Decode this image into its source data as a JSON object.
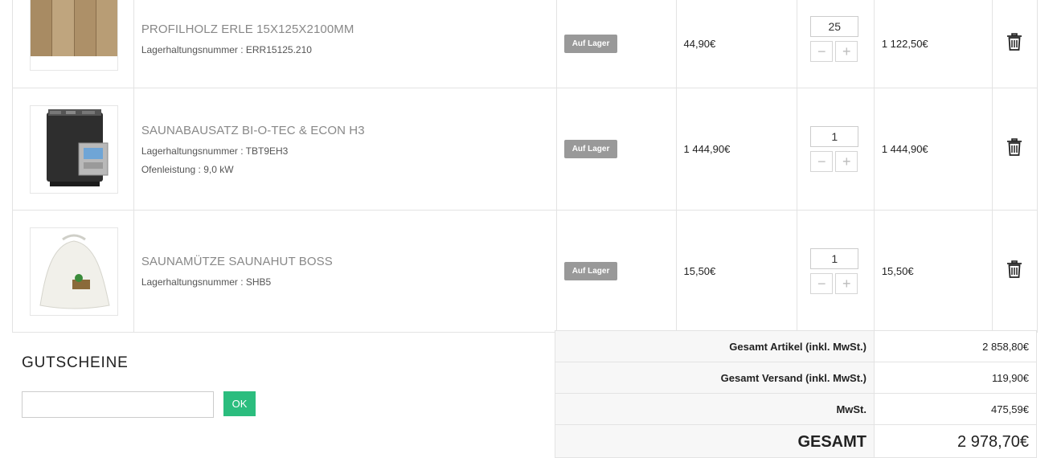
{
  "cart": {
    "items": [
      {
        "name": "PROFILHOLZ ERLE 15X125X2100MM",
        "sku_line": "Lagerhaltungsnummer : ERR15125.210",
        "extra_line": "",
        "stock": "Auf Lager",
        "unit_price": "44,90€",
        "quantity": "25",
        "total": "1 122,50€",
        "image": "wood-panel-image"
      },
      {
        "name": "SAUNABAUSATZ BI-O-TEC & ECON H3",
        "sku_line": "Lagerhaltungsnummer : TBT9EH3",
        "extra_line": "Ofenleistung : 9,0 kW",
        "stock": "Auf Lager",
        "unit_price": "1 444,90€",
        "quantity": "1",
        "total": "1 444,90€",
        "image": "sauna-heater-image"
      },
      {
        "name": "SAUNAMÜTZE SAUNAHUT BOSS",
        "sku_line": "Lagerhaltungsnummer : SHB5",
        "extra_line": "",
        "stock": "Auf Lager",
        "unit_price": "15,50€",
        "quantity": "1",
        "total": "15,50€",
        "image": "sauna-hat-image"
      }
    ],
    "qty_minus": "−",
    "qty_plus": "+"
  },
  "coupons": {
    "title": "GUTSCHEINE",
    "input_value": "",
    "ok_label": "OK"
  },
  "totals": {
    "rows": [
      {
        "label": "Gesamt Artikel (inkl. MwSt.)",
        "value": "2 858,80€"
      },
      {
        "label": "Gesamt Versand (inkl. MwSt.)",
        "value": "119,90€"
      },
      {
        "label": "MwSt.",
        "value": "475,59€"
      }
    ],
    "grand_label": "GESAMT",
    "grand_value": "2 978,70€"
  },
  "colors": {
    "accent_button": "#2bbd7e",
    "stock_badge": "#999999"
  }
}
